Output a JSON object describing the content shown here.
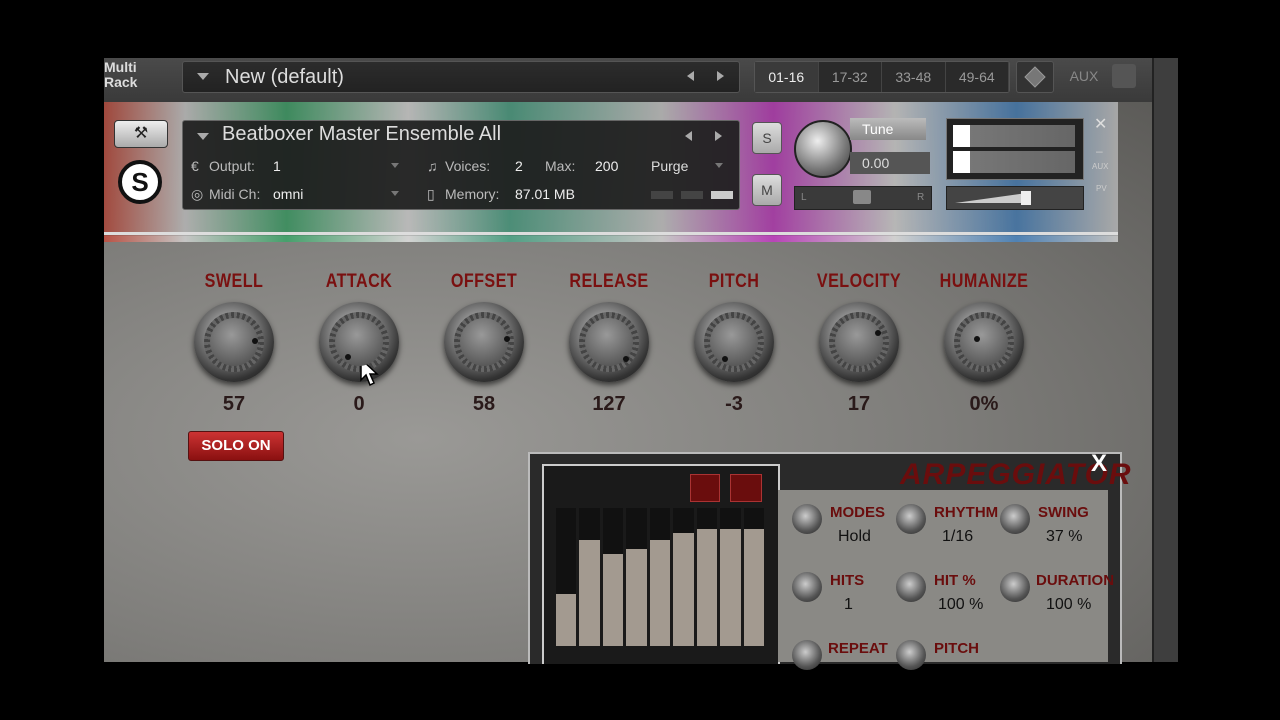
{
  "rack": {
    "label_line1": "Multi",
    "label_line2": "Rack",
    "multi_name": "New (default)",
    "channels": [
      "01-16",
      "17-32",
      "33-48",
      "49-64"
    ],
    "aux_label": "AUX"
  },
  "instrument": {
    "name": "Beatboxer Master Ensemble All",
    "output_label": "Output:",
    "output_value": "1",
    "midi_label": "Midi Ch:",
    "midi_value": "omni",
    "voices_label": "Voices:",
    "voices_value": "2",
    "max_label": "Max:",
    "max_value": "200",
    "purge_label": "Purge",
    "memory_label": "Memory:",
    "memory_value": "87.01 MB",
    "solo_label": "S",
    "mute_label": "M",
    "tune_label": "Tune",
    "tune_value": "0.00",
    "pan_left": "L",
    "pan_right": "R",
    "side_aux": "AUX",
    "side_pv": "PV"
  },
  "knobs": [
    {
      "label": "SWELL",
      "value": "57"
    },
    {
      "label": "ATTACK",
      "value": "0"
    },
    {
      "label": "OFFSET",
      "value": "58"
    },
    {
      "label": "RELEASE",
      "value": "127"
    },
    {
      "label": "PITCH",
      "value": "-3"
    },
    {
      "label": "VELOCITY",
      "value": "17"
    },
    {
      "label": "HUMANIZE",
      "value": "0%"
    }
  ],
  "solo_on_label": "SOLO ON",
  "arpeggiator": {
    "title": "ARPEGGIATOR",
    "close": "X",
    "step_levels": [
      0.38,
      0.77,
      0.67,
      0.7,
      0.77,
      0.82,
      0.85,
      0.85,
      0.85
    ],
    "params": {
      "modes": {
        "label": "MODES",
        "value": "Hold"
      },
      "rhythm": {
        "label": "RHYTHM",
        "value": "1/16"
      },
      "swing": {
        "label": "SWING",
        "value": "37 %"
      },
      "hits": {
        "label": "HITS",
        "value": "1"
      },
      "hit_pct": {
        "label": "HIT %",
        "value": "100 %"
      },
      "duration": {
        "label": "DURATION",
        "value": "100 %"
      },
      "repeat": {
        "label": "REPEAT"
      },
      "pitch": {
        "label": "PITCH"
      }
    }
  },
  "colors": {
    "label_red": "#7a1010",
    "arp_red": "#6a0d0d",
    "solo_btn": "#a31b1b"
  }
}
